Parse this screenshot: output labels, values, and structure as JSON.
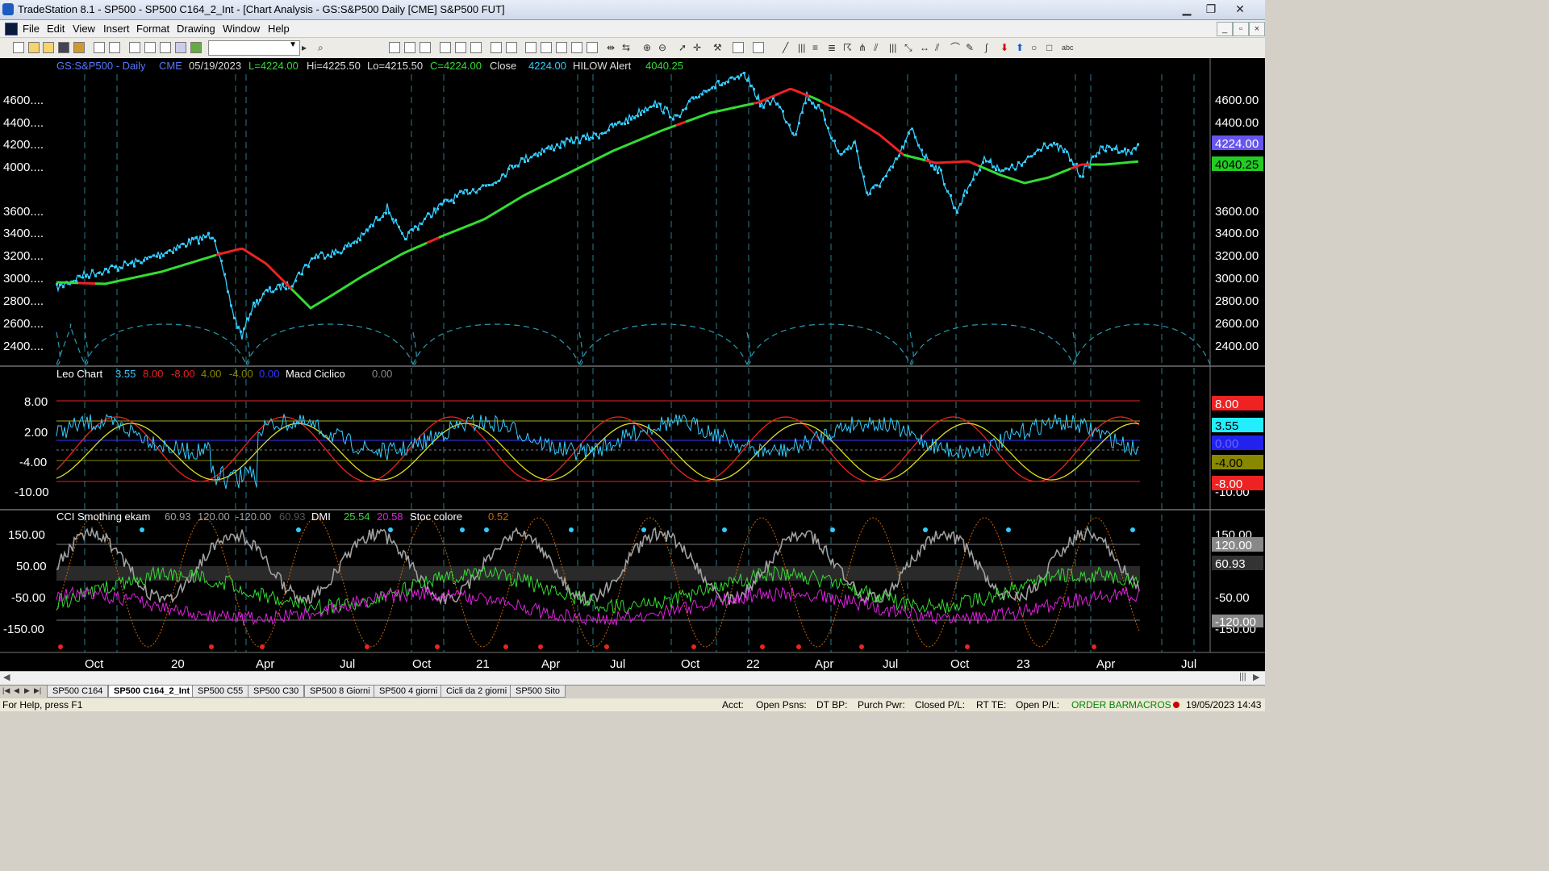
{
  "window": {
    "title": "TradeStation 8.1 - SP500 - SP500 C164_2_Int - [Chart Analysis - GS:S&P500  Daily  [CME] S&P500 FUT]",
    "minimize": "▁",
    "restore": "❐",
    "close": "✕"
  },
  "menu": [
    "File",
    "Edit",
    "View",
    "Insert",
    "Format",
    "Drawing",
    "Window",
    "Help"
  ],
  "chart": {
    "header": {
      "symbol": "GS:S&P500 - Daily",
      "exchange": "CME",
      "date": "05/19/2023",
      "last": "L=4224.00",
      "high": "Hi=4225.50",
      "low": "Lo=4215.50",
      "close_val": "C=4224.00",
      "close_label": "Close",
      "close_num": "4224.00",
      "alert_label": "HILOW Alert",
      "alert_val": "4040.25"
    },
    "price_ticks": [
      "4600.00",
      "4400.00",
      "4200.00",
      "4000.00",
      "3600.00",
      "3400.00",
      "3200.00",
      "3000.00",
      "2800.00",
      "2600.00",
      "2400.00"
    ],
    "price_left_ticks": [
      "4600....",
      "4400....",
      "4200....",
      "4000....",
      "3600....",
      "3400....",
      "3200....",
      "3000....",
      "2800....",
      "2600....",
      "2400...."
    ],
    "price_flags": {
      "close": "4224.00",
      "alert": "4040.25"
    },
    "macd": {
      "name": "Leo Chart",
      "v1": "3.55",
      "v2": "8.00",
      "v3": "-8.00",
      "v4": "4.00",
      "v5": "-4.00",
      "v6": "0.00",
      "name2": "Macd Ciclico",
      "v7": "0.00",
      "ticks_left": [
        "8.00",
        "2.00",
        "-4.00",
        "-10.00"
      ],
      "ticks_right": [
        "-10.00"
      ],
      "flags": {
        "red": "8.00",
        "cyan": "3.55",
        "blue": "0.00",
        "olive": "-4.00",
        "red2": "-8.00"
      }
    },
    "cci": {
      "name": "CCI Smothing ekam",
      "v1": "60.93",
      "v2": "120.00",
      "v3": "-120.00",
      "v4": "60.93",
      "dmi_label": "DMI",
      "dmi1": "25.54",
      "dmi2": "20.58",
      "stoc_label": "Stoc colore",
      "stoc": "0.52",
      "ticks_left": [
        "150.00",
        "50.00",
        "-50.00",
        "-150.00"
      ],
      "ticks_right": [
        "150.00",
        "-50.00",
        "-150.00"
      ],
      "flags": {
        "f120": "120.00",
        "f60": "60.93",
        "fm120": "-120.00"
      }
    },
    "time_labels": [
      "Oct",
      "20",
      "Apr",
      "Jul",
      "Oct",
      "21",
      "Apr",
      "Jul",
      "Oct",
      "22",
      "Apr",
      "Jul",
      "Oct",
      "23",
      "Apr",
      "Jul"
    ]
  },
  "tabs": [
    "SP500 C164",
    "SP500 C164_2_Int",
    "SP500 C55",
    "SP500 C30",
    "SP500 8 Giorni",
    "SP500 4 giorni",
    "Cicli da 2 giorni",
    "SP500 Sito"
  ],
  "status": {
    "help": "For Help, press F1",
    "acct": "Acct:",
    "open_psns": "Open Psns:",
    "dt_bp": "DT BP:",
    "purch_pwr": "Purch Pwr:",
    "closed_pl": "Closed P/L:",
    "rt_te": "RT TE:",
    "open_pl": "Open P/L:",
    "order_bar": "ORDER BAR",
    "macros": "MACROS",
    "datetime": "19/05/2023 14:43"
  },
  "colors": {
    "cyan": "#33ccff",
    "green": "#33dd33",
    "red": "#ee2222",
    "yellow": "#dddd22",
    "olive": "#888800",
    "magenta": "#dd22dd",
    "gray": "#a0a0a0"
  }
}
